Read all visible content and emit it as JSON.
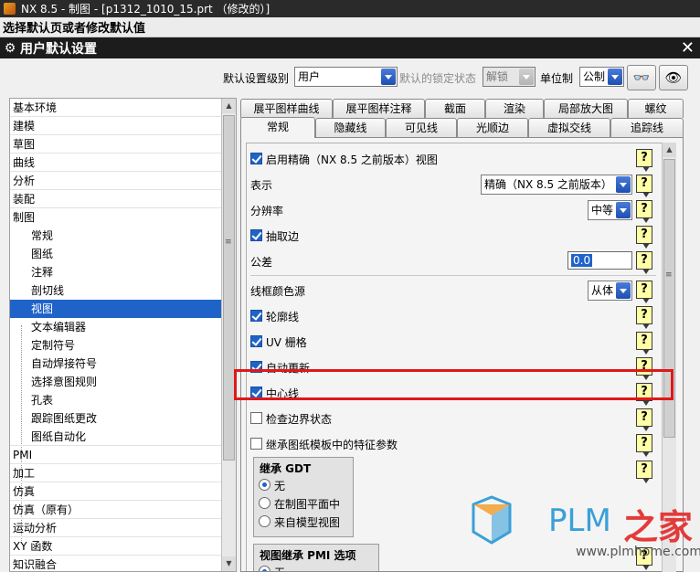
{
  "window": {
    "title": "NX 8.5 - 制图 - [p1312_1010_15.prt （修改的）]"
  },
  "status_prompt": "选择默认页或者修改默认值",
  "dialog": {
    "title": "用户默认设置"
  },
  "top": {
    "level_label": "默认设置级别",
    "level_value": "用户",
    "lock_label": "默认的锁定状态",
    "lock_value": "解锁",
    "unit_label": "单位制",
    "unit_value": "公制"
  },
  "tree": {
    "items": [
      "基本环境",
      "建模",
      "草图",
      "曲线",
      "分析",
      "装配",
      "制图",
      "常规",
      "图纸",
      "注释",
      "剖切线",
      "视图",
      "文本编辑器",
      "定制符号",
      "自动焊接符号",
      "选择意图规则",
      "孔表",
      "跟踪图纸更改",
      "图纸自动化",
      "PMI",
      "加工",
      "仿真",
      "仿真（原有）",
      "运动分析",
      "XY 函数",
      "知识融合"
    ]
  },
  "tabs": {
    "row1": [
      "展平图样曲线",
      "展平图样注释",
      "截面",
      "渲染",
      "局部放大图",
      "螺纹"
    ],
    "row2": [
      "常规",
      "隐藏线",
      "可见线",
      "光顺边",
      "虚拟交线",
      "追踪线"
    ]
  },
  "settings": {
    "enable_precise": "启用精确（NX 8.5 之前版本）视图",
    "representation_label": "表示",
    "representation_value": "精确（NX 8.5 之前版本）",
    "resolution_label": "分辨率",
    "resolution_value": "中等",
    "extract_edges": "抽取边",
    "tolerance_label": "公差",
    "tolerance_value": "0.0",
    "wire_color_label": "线框颜色源",
    "wire_color_value": "从体",
    "silhouettes": "轮廓线",
    "uv_hatch": "UV 栅格",
    "auto_update": "自动更新",
    "centerline": "中心线",
    "check_boundary": "检查边界状态",
    "inherit_feature": "继承图纸模板中的特征参数",
    "gdt_title": "继承 GDT",
    "gdt_options": [
      "无",
      "在制图平面中",
      "来自模型视图"
    ],
    "pmi_title": "视图继承 PMI 选项",
    "pmi_first": "无",
    "help_symbol": "?"
  },
  "watermark": {
    "brand": "PLM",
    "cn": "之家",
    "url": "www.plmhome.com"
  },
  "colors": {
    "selection": "#1f63c9",
    "highlight": "#e01818",
    "help_bg": "#ffffa8"
  }
}
